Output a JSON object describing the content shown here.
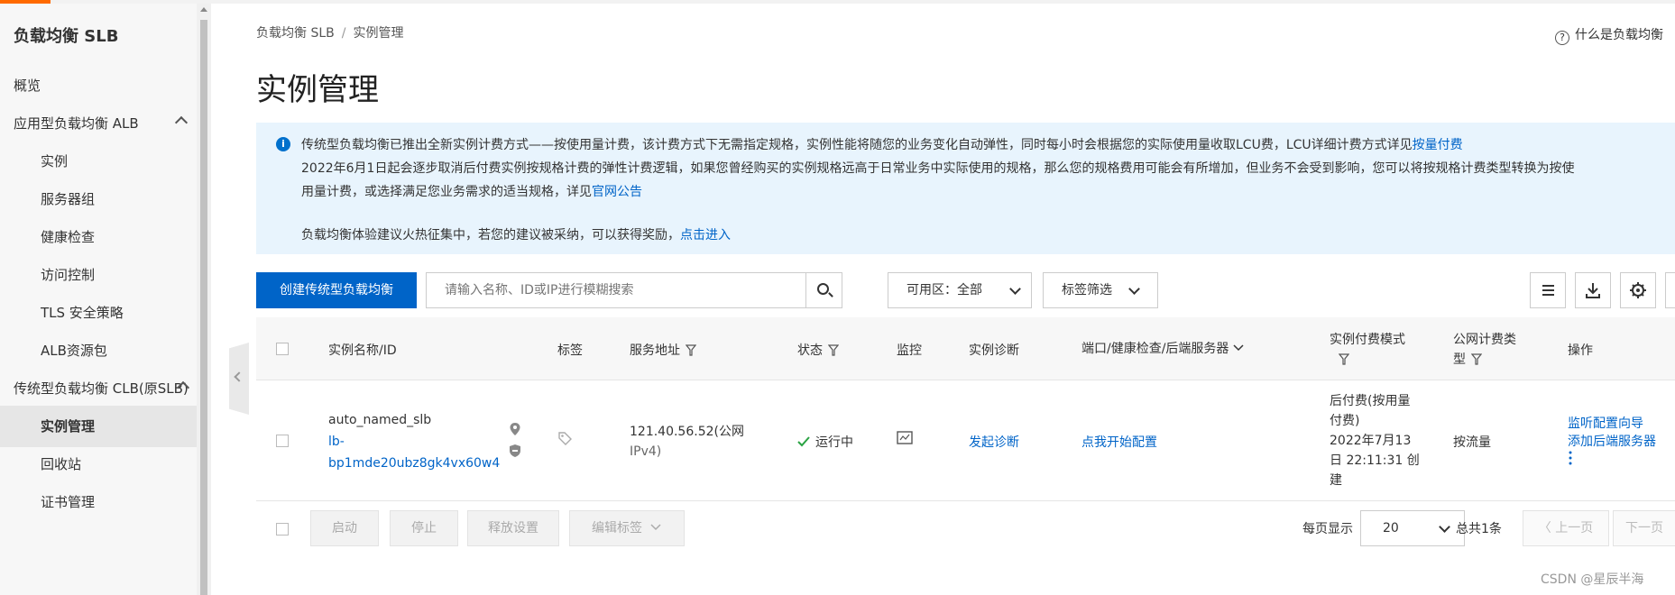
{
  "sidebar": {
    "title": "负载均衡 SLB",
    "items": [
      {
        "label": "概览"
      },
      {
        "label": "应用型负载均衡 ALB"
      },
      {
        "label": "实例"
      },
      {
        "label": "服务器组"
      },
      {
        "label": "健康检查"
      },
      {
        "label": "访问控制"
      },
      {
        "label": "TLS 安全策略"
      },
      {
        "label": "ALB资源包"
      },
      {
        "label": "传统型负载均衡 CLB(原SLB)"
      },
      {
        "label": "实例管理"
      },
      {
        "label": "回收站"
      },
      {
        "label": "证书管理"
      }
    ]
  },
  "breadcrumb": {
    "root": "负载均衡 SLB",
    "sep": "/",
    "current": "实例管理"
  },
  "help": {
    "label": "什么是负载均衡"
  },
  "page": {
    "title": "实例管理"
  },
  "notice": {
    "line1_text": "传统型负载均衡已推出全新实例计费方式——按使用量计费，该计费方式下无需指定规格，实例性能将随您的业务变化自动弹性，同时每小时会根据您的实际使用量收取LCU费，LCU详细计费方式详见",
    "line1_link": "按量付费",
    "line2_text": "2022年6月1日起会逐步取消后付费实例按规格计费的弹性计费逻辑，如果您曾经购买的实例规格远高于日常业务中实际使用的规格，那么您的规格费用可能会有所增加，但业务不会受到影响，您可以将按规格计费类型转换为按使",
    "line3_text": "用量计费，或选择满足您业务需求的适当规格，详见",
    "line3_link": "官网公告",
    "line4_text": "负载均衡体验建议火热征集中，若您的建议被采纳，可以获得奖励，",
    "line4_link": "点击进入"
  },
  "toolbar": {
    "create_label": "创建传统型负载均衡",
    "search_placeholder": "请输入名称、ID或IP进行模糊搜索",
    "zone_label": "可用区：全部",
    "tag_filter_label": "标签筛选"
  },
  "table": {
    "headers": {
      "name": "实例名称/ID",
      "tag": "标签",
      "address": "服务地址",
      "status": "状态",
      "monitor": "监控",
      "diagnose": "实例诊断",
      "ports": "端口/健康检查/后端服务器",
      "pay_mode": "实例付费模式",
      "net_type_1": "公网计费类",
      "net_type_2": "型",
      "actions": "操作"
    },
    "rows": [
      {
        "name": "auto_named_slb",
        "id_1": "lb-",
        "id_2": "bp1mde20ubz8gk4vx60w4",
        "addr_1": "121.40.56.52(公网",
        "addr_2": "IPv4)",
        "status": "运行中",
        "diagnose": "发起诊断",
        "ports": "点我开始配置",
        "pay_1": "后付费(按用量",
        "pay_2": "付费)",
        "pay_3": "2022年7月13",
        "pay_4": "日 22:11:31 创",
        "pay_5": "建",
        "net_type": "按流量",
        "action_1": "监听配置向导",
        "action_2": "添加后端服务器"
      }
    ]
  },
  "footer": {
    "start": "启动",
    "stop": "停止",
    "release": "释放设置",
    "edit_tags": "编辑标签",
    "per_page_label": "每页显示",
    "per_page_value": "20",
    "total": "总共1条",
    "prev": "上一页",
    "next": "下一页"
  },
  "watermark": "CSDN @星辰半海",
  "colors": {
    "primary": "#0064c8",
    "accent": "#ff6a00",
    "success": "#2aa343",
    "notice_bg": "#e8f4fd"
  }
}
